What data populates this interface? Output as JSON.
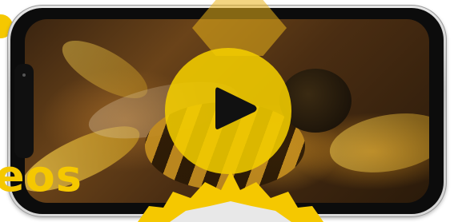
{
  "hero": {
    "headline_fragment": "eos",
    "play_button_label": "Play video"
  },
  "media": {
    "subject": "bee-on-flower-photo"
  },
  "colors": {
    "accent_yellow": "#f5c800",
    "hexagon_yellow": "#e9b21a",
    "phone_frame": "#cfcfcf",
    "screen_bezel": "#0c0c0c"
  },
  "icons": [
    "play-icon",
    "hexagon-decoration",
    "star-burst-badge",
    "yellow-dot-decoration"
  ]
}
